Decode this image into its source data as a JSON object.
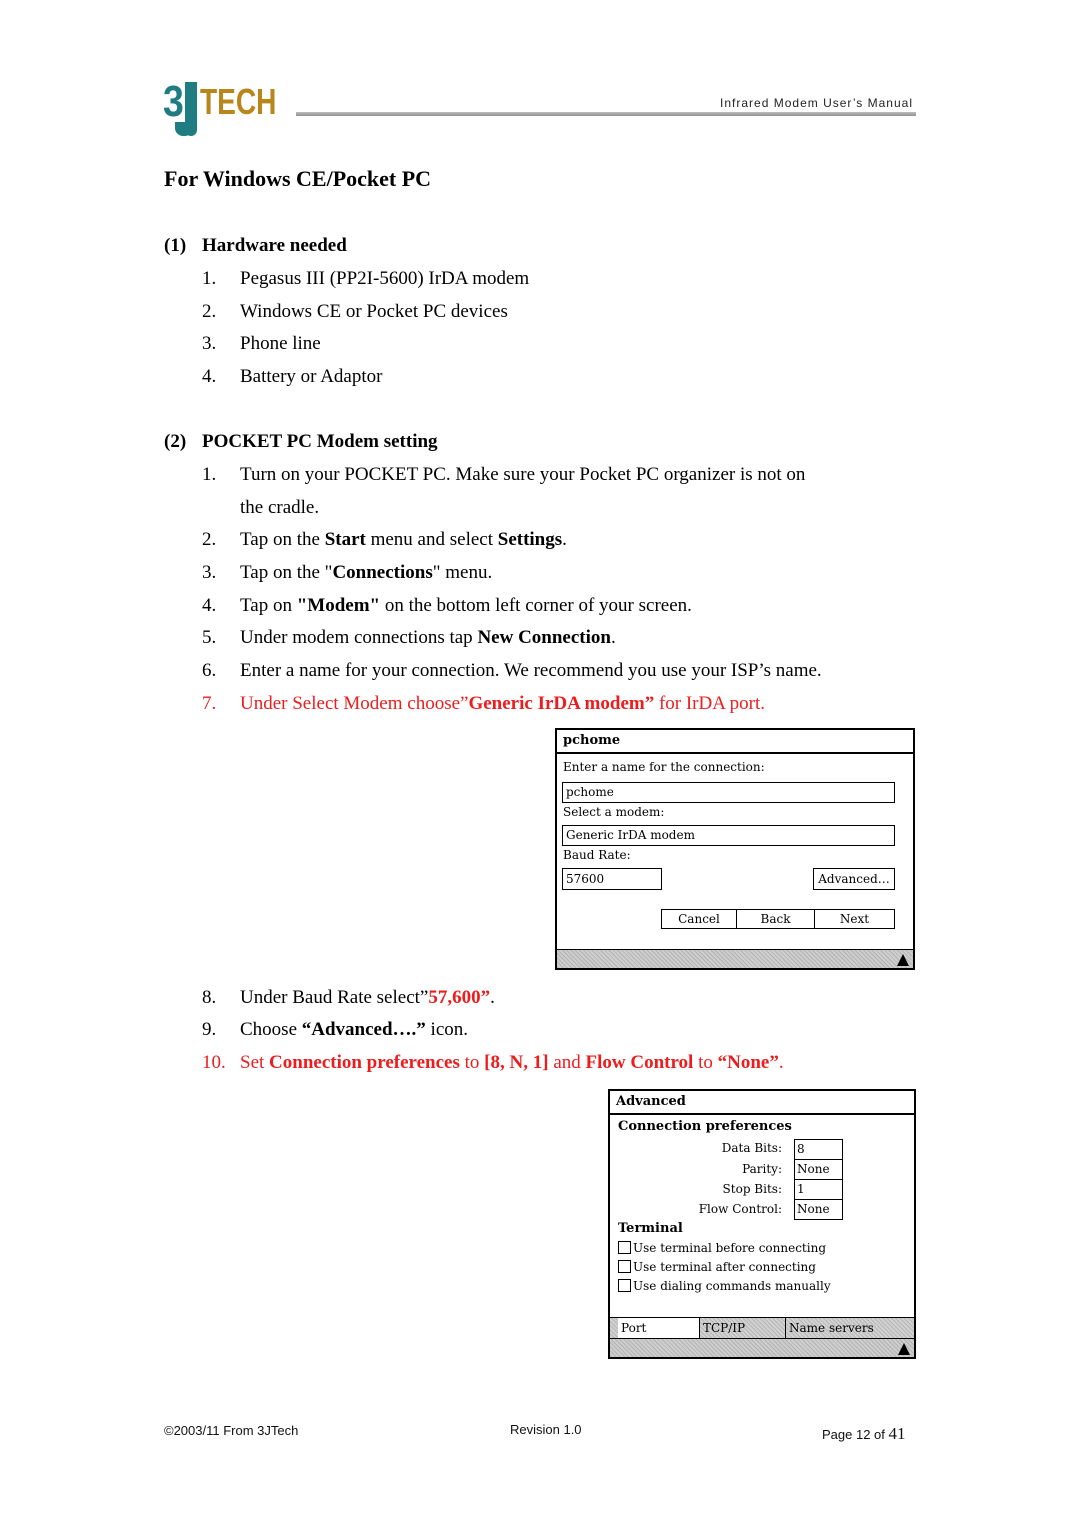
{
  "header": {
    "logo": {
      "digit": "3",
      "letter": "J",
      "word": "TECH",
      "colors": {
        "teal": "#1f7d82",
        "gold": "#b8861b"
      }
    },
    "doc_title": "Infrared Modem User’s Manual"
  },
  "title": "For Windows CE/Pocket PC",
  "section1": {
    "num": "(1)",
    "heading": "Hardware needed",
    "items": [
      {
        "n": "1.",
        "text": "Pegasus III (PP2I-5600) IrDA modem"
      },
      {
        "n": "2.",
        "text": "Windows CE or Pocket PC devices"
      },
      {
        "n": "3.",
        "text": "Phone line"
      },
      {
        "n": "4.",
        "text": "Battery or Adaptor"
      }
    ]
  },
  "section2": {
    "num": "(2)",
    "heading": "POCKET PC Modem setting",
    "steps": {
      "s1": {
        "n": "1.",
        "a": "Turn on your POCKET PC. Make sure your Pocket PC organizer is not on",
        "b": "the cradle."
      },
      "s2": {
        "n": "2.",
        "a": "Tap on the ",
        "b1": "Start",
        "c": " menu and select ",
        "b2": "Settings",
        "d": "."
      },
      "s3": {
        "n": "3.",
        "a": "Tap on the \"",
        "b1": "Connections",
        "c": "\" menu."
      },
      "s4": {
        "n": "4.",
        "a": "Tap on ",
        "b1": "\"Modem\"",
        "c": " on the bottom left corner of your screen."
      },
      "s5": {
        "n": "5.",
        "a": "Under modem connections tap ",
        "b1": "New Connection",
        "c": "."
      },
      "s6": {
        "n": "6.",
        "a": "Enter a name for your connection. We recommend you use your ISP’s name."
      },
      "s7": {
        "n": "7.",
        "a": "Under Select Modem choose”",
        "b1": "Generic IrDA modem”",
        "c": " for IrDA port."
      },
      "s8": {
        "n": "8.",
        "a": "Under Baud Rate select”",
        "b1": "57,600”",
        "c": "."
      },
      "s9": {
        "n": "9.",
        "a": "Choose ",
        "b1": "“Advanced….”",
        "c": " icon."
      },
      "s10": {
        "n": "10.",
        "a": "Set ",
        "b1": "Connection preferences",
        "c": " to ",
        "b2": "[8, N, 1]",
        "d": " and ",
        "b3": "Flow Control",
        "e": " to ",
        "b4": "“None”",
        "f": "."
      }
    },
    "accent_color": "#ee1c1c"
  },
  "screen1": {
    "title": "pchome",
    "name_label": "Enter a name for the connection:",
    "name_value": "pchome",
    "modem_label": "Select a modem:",
    "modem_value": "Generic IrDA modem",
    "baud_label": "Baud Rate:",
    "baud_value": "57600",
    "advanced_button": "Advanced…",
    "cancel_button": "Cancel",
    "back_button": "Back",
    "next_button": "Next"
  },
  "screen2": {
    "title": "Advanced",
    "conn_pref_heading": "Connection preferences",
    "fields": [
      {
        "label": "Data Bits:",
        "value": "8"
      },
      {
        "label": "Parity:",
        "value": "None"
      },
      {
        "label": "Stop Bits:",
        "value": "1"
      },
      {
        "label": "Flow Control:",
        "value": "None"
      }
    ],
    "terminal_heading": "Terminal",
    "checkboxes": [
      {
        "label": "Use terminal before connecting",
        "checked": false
      },
      {
        "label": "Use terminal after connecting",
        "checked": false
      },
      {
        "label": "Use dialing commands manually",
        "checked": false
      }
    ],
    "tabs": [
      {
        "label": "Port Settings",
        "active": true
      },
      {
        "label": "TCP/IP",
        "active": false
      },
      {
        "label": "Name servers",
        "active": false
      }
    ]
  },
  "footer": {
    "copyright": "©2003/11 From 3JTech",
    "revision": "Revision 1.0",
    "page_prefix": "Page 12 of ",
    "page_total": "41"
  }
}
